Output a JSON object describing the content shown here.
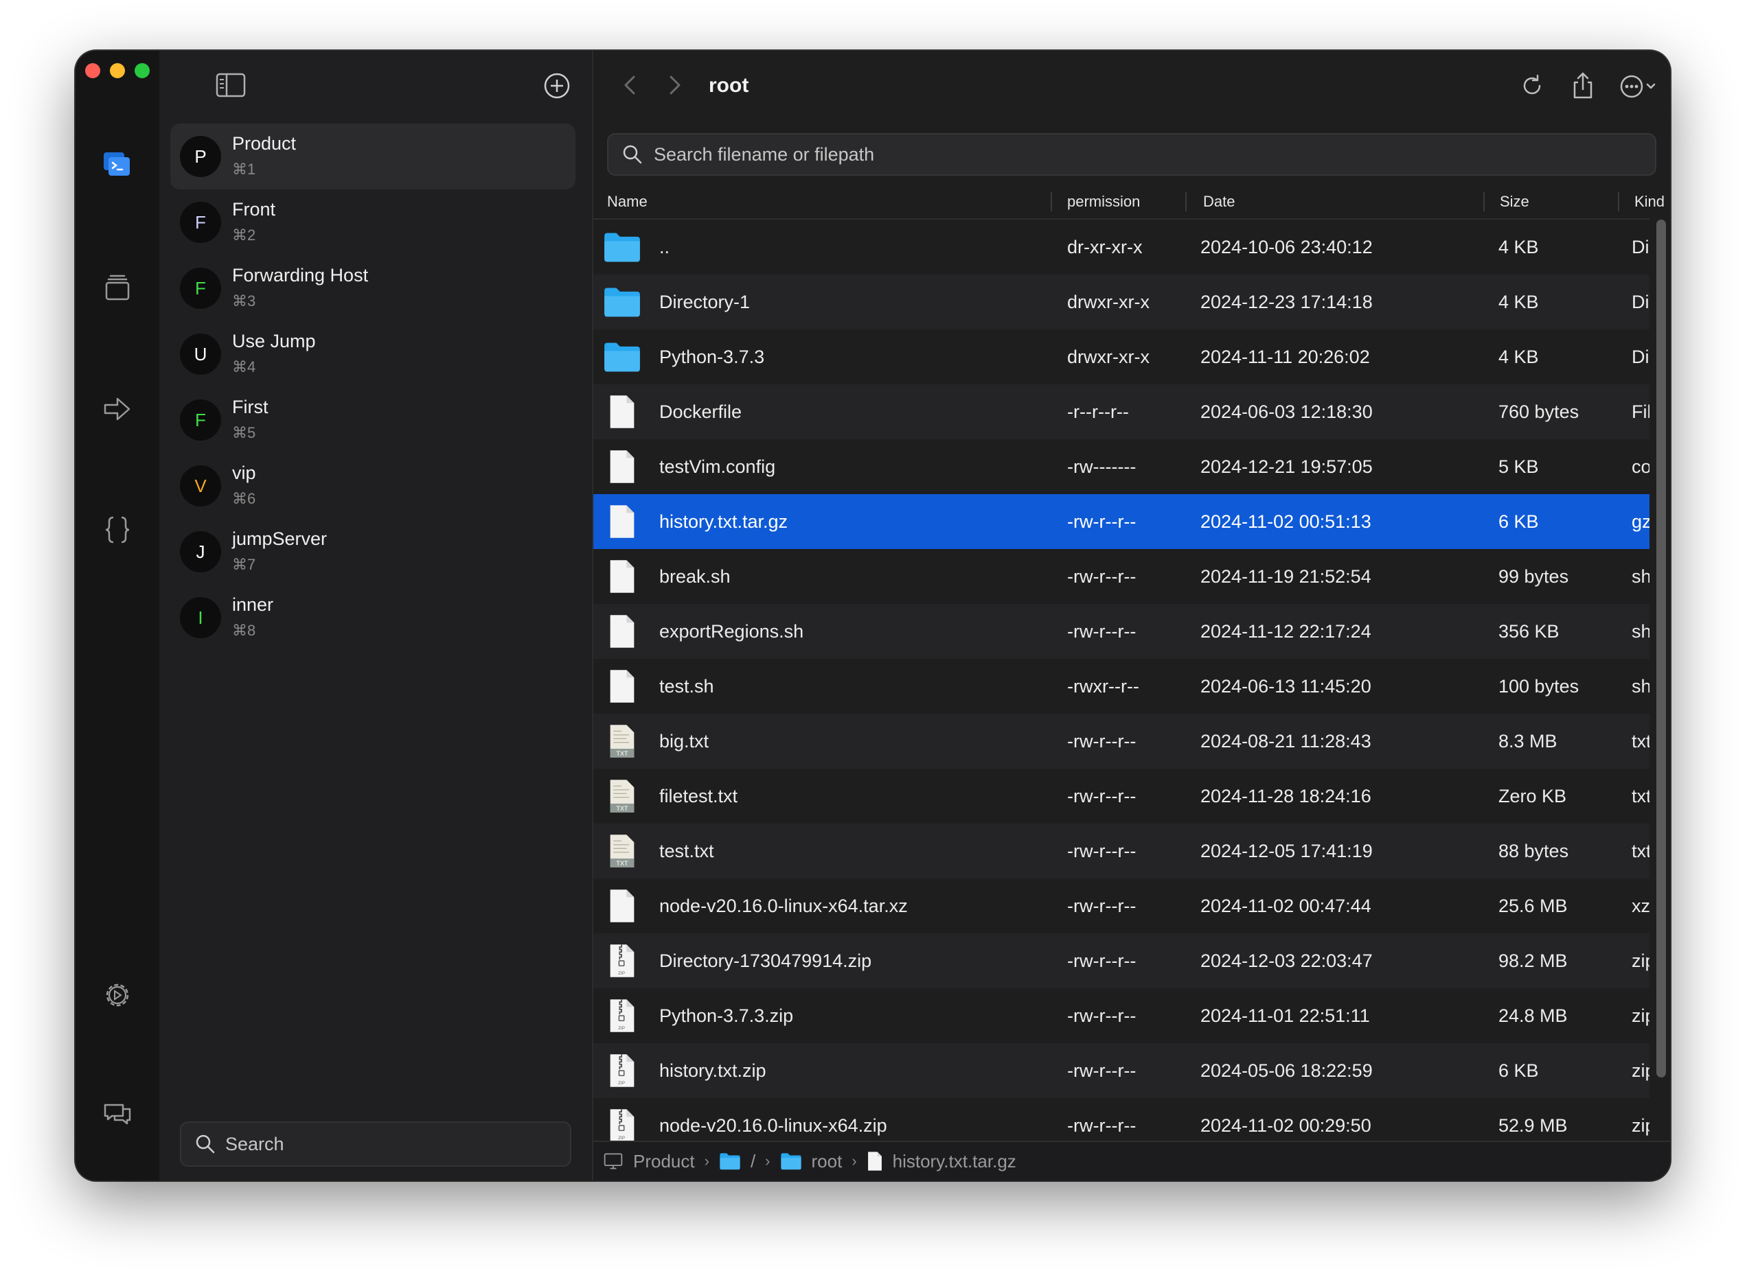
{
  "window": {
    "title": "root"
  },
  "hosts": [
    {
      "initial": "P",
      "name": "Product",
      "shortcut": "⌘1",
      "color": "#ffffff",
      "active": true
    },
    {
      "initial": "F",
      "name": "Front",
      "shortcut": "⌘2",
      "color": "#d0d0ff",
      "active": false
    },
    {
      "initial": "F",
      "name": "Forwarding Host",
      "shortcut": "⌘3",
      "color": "#3fe04a",
      "active": false
    },
    {
      "initial": "U",
      "name": "Use Jump",
      "shortcut": "⌘4",
      "color": "#ffffff",
      "active": false
    },
    {
      "initial": "F",
      "name": "First",
      "shortcut": "⌘5",
      "color": "#3fe04a",
      "active": false
    },
    {
      "initial": "V",
      "name": "vip",
      "shortcut": "⌘6",
      "color": "#f5a623",
      "active": false
    },
    {
      "initial": "J",
      "name": "jumpServer",
      "shortcut": "⌘7",
      "color": "#ffffff",
      "active": false
    },
    {
      "initial": "I",
      "name": "inner",
      "shortcut": "⌘8",
      "color": "#3fe04a",
      "active": false
    }
  ],
  "sidebar": {
    "search_label": "Search"
  },
  "main": {
    "title": "root",
    "search_placeholder": "Search filename or filepath",
    "columns": {
      "name": "Name",
      "permission": "permission",
      "date": "Date",
      "size": "Size",
      "kind": "Kind"
    }
  },
  "files": [
    {
      "icon": "folder",
      "name": "..",
      "permission": "dr-xr-xr-x",
      "date": "2024-10-06 23:40:12",
      "size": "4 KB",
      "kind": "Directory",
      "selected": false
    },
    {
      "icon": "folder",
      "name": "Directory-1",
      "permission": "drwxr-xr-x",
      "date": "2024-12-23 17:14:18",
      "size": "4 KB",
      "kind": "Directory",
      "selected": false
    },
    {
      "icon": "folder",
      "name": "Python-3.7.3",
      "permission": "drwxr-xr-x",
      "date": "2024-11-11 20:26:02",
      "size": "4 KB",
      "kind": "Directory",
      "selected": false
    },
    {
      "icon": "file",
      "name": "Dockerfile",
      "permission": "-r--r--r--",
      "date": "2024-06-03 12:18:30",
      "size": "760 bytes",
      "kind": "File",
      "selected": false
    },
    {
      "icon": "file",
      "name": "testVim.config",
      "permission": "-rw-------",
      "date": "2024-12-21 19:57:05",
      "size": "5 KB",
      "kind": "config",
      "selected": false
    },
    {
      "icon": "file",
      "name": "history.txt.tar.gz",
      "permission": "-rw-r--r--",
      "date": "2024-11-02 00:51:13",
      "size": "6 KB",
      "kind": "gz",
      "selected": true
    },
    {
      "icon": "file",
      "name": "break.sh",
      "permission": "-rw-r--r--",
      "date": "2024-11-19 21:52:54",
      "size": "99 bytes",
      "kind": "sh",
      "selected": false
    },
    {
      "icon": "file",
      "name": "exportRegions.sh",
      "permission": "-rw-r--r--",
      "date": "2024-11-12 22:17:24",
      "size": "356 KB",
      "kind": "sh",
      "selected": false
    },
    {
      "icon": "file",
      "name": "test.sh",
      "permission": "-rwxr--r--",
      "date": "2024-06-13 11:45:20",
      "size": "100 bytes",
      "kind": "sh",
      "selected": false
    },
    {
      "icon": "txt",
      "name": "big.txt",
      "permission": "-rw-r--r--",
      "date": "2024-08-21 11:28:43",
      "size": "8.3 MB",
      "kind": "txt",
      "selected": false
    },
    {
      "icon": "txt",
      "name": "filetest.txt",
      "permission": "-rw-r--r--",
      "date": "2024-11-28 18:24:16",
      "size": "Zero KB",
      "kind": "txt",
      "selected": false
    },
    {
      "icon": "txt",
      "name": "test.txt",
      "permission": "-rw-r--r--",
      "date": "2024-12-05 17:41:19",
      "size": "88 bytes",
      "kind": "txt",
      "selected": false
    },
    {
      "icon": "file",
      "name": "node-v20.16.0-linux-x64.tar.xz",
      "permission": "-rw-r--r--",
      "date": "2024-11-02 00:47:44",
      "size": "25.6 MB",
      "kind": "xz",
      "selected": false
    },
    {
      "icon": "zip",
      "name": "Directory-1730479914.zip",
      "permission": "-rw-r--r--",
      "date": "2024-12-03 22:03:47",
      "size": "98.2 MB",
      "kind": "zip",
      "selected": false
    },
    {
      "icon": "zip",
      "name": "Python-3.7.3.zip",
      "permission": "-rw-r--r--",
      "date": "2024-11-01 22:51:11",
      "size": "24.8 MB",
      "kind": "zip",
      "selected": false
    },
    {
      "icon": "zip",
      "name": "history.txt.zip",
      "permission": "-rw-r--r--",
      "date": "2024-05-06 18:22:59",
      "size": "6 KB",
      "kind": "zip",
      "selected": false
    },
    {
      "icon": "zip",
      "name": "node-v20.16.0-linux-x64.zip",
      "permission": "-rw-r--r--",
      "date": "2024-11-02 00:29:50",
      "size": "52.9 MB",
      "kind": "zip",
      "selected": false
    }
  ],
  "breadcrumb": [
    {
      "icon": "computer",
      "label": "Product"
    },
    {
      "icon": "folder",
      "label": "/"
    },
    {
      "icon": "folder",
      "label": "root"
    },
    {
      "icon": "file",
      "label": "history.txt.tar.gz"
    }
  ],
  "txt_badge": "TXT",
  "zip_badge": "ZIP",
  "colors": {
    "accent": "#0f5ad6",
    "folder": "#29a8ef",
    "rail_active": "#3a8ef6"
  }
}
